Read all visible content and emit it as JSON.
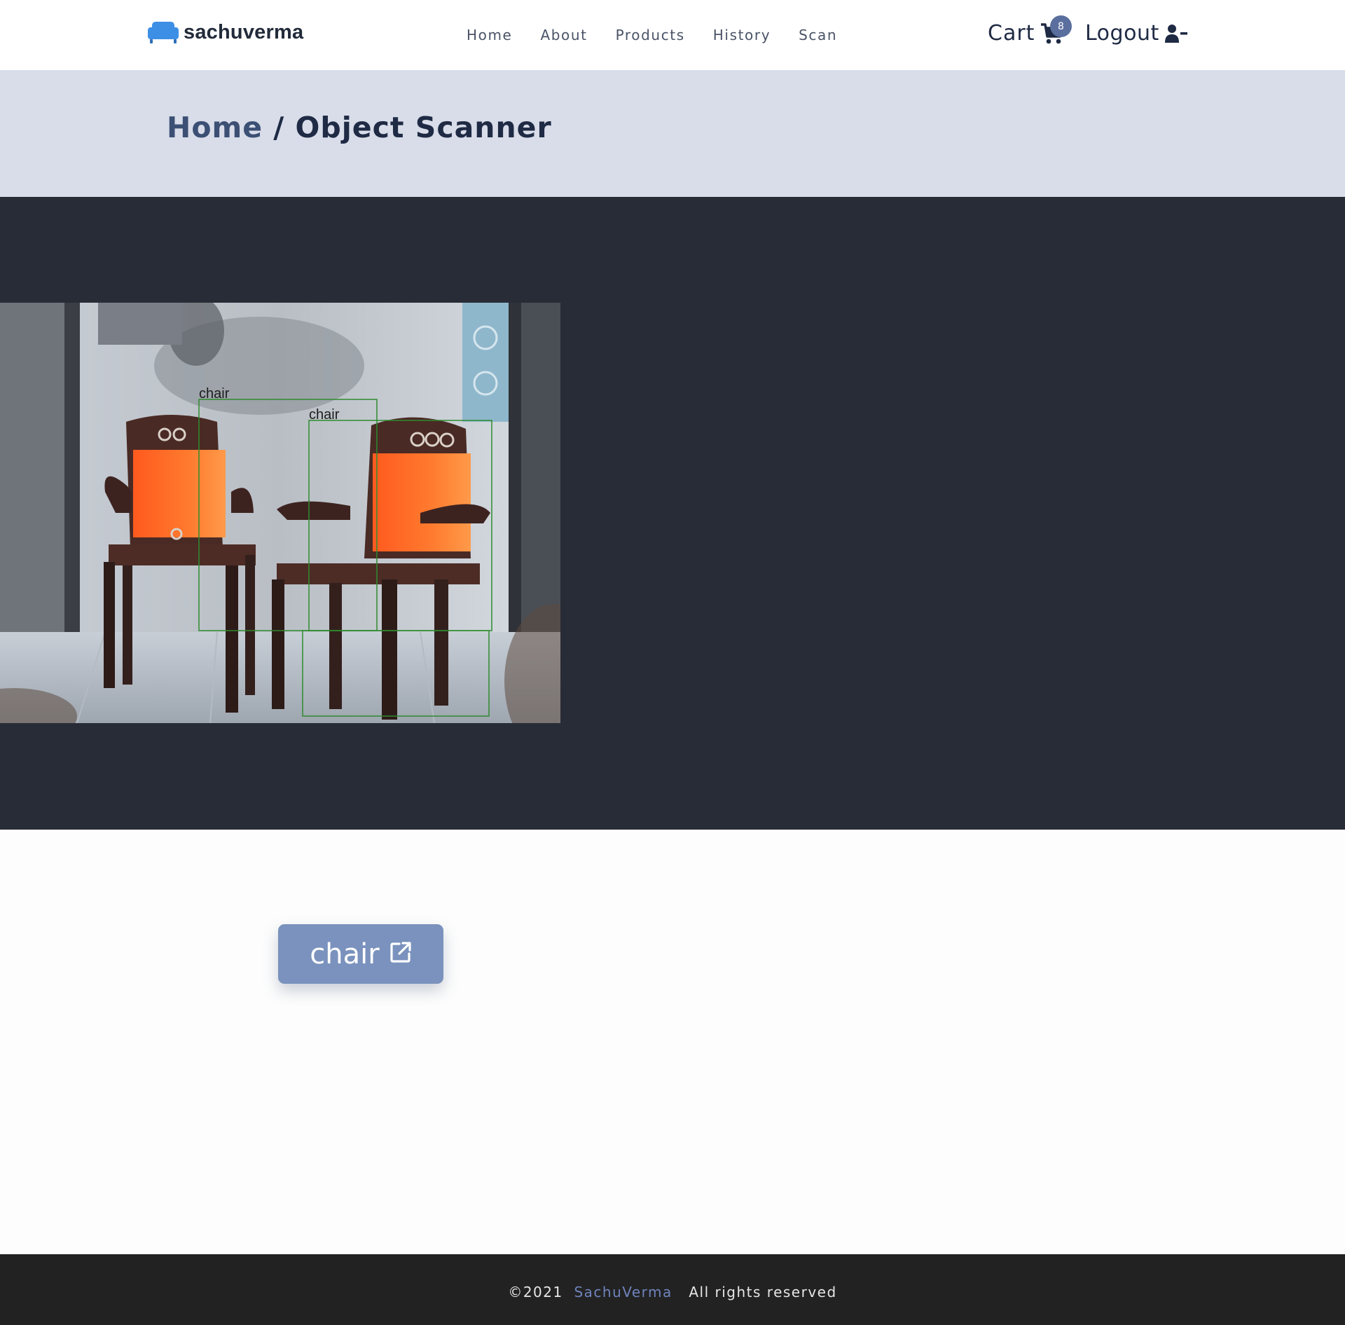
{
  "navbar": {
    "brand": "sachuverma",
    "links": [
      "Home",
      "About",
      "Products",
      "History",
      "Scan"
    ],
    "cart_label": "Cart",
    "cart_count": "8",
    "logout_label": "Logout"
  },
  "breadcrumb": {
    "home": "Home",
    "separator": " / ",
    "current": "Object Scanner"
  },
  "scanner": {
    "detections": [
      "chair",
      "chair"
    ]
  },
  "result": {
    "label": "chair",
    "icon": "external-link-icon"
  },
  "footer": {
    "copyright": "©2021",
    "link": "SachuVerma",
    "rights": "All rights reserved"
  },
  "colors": {
    "accent": "#7a92bd",
    "badge": "#5b6f9e",
    "banner": "#d8dde9",
    "scanner_bg": "#282c36",
    "footer_bg": "#222222",
    "detection_box": "#2e8b2e"
  }
}
